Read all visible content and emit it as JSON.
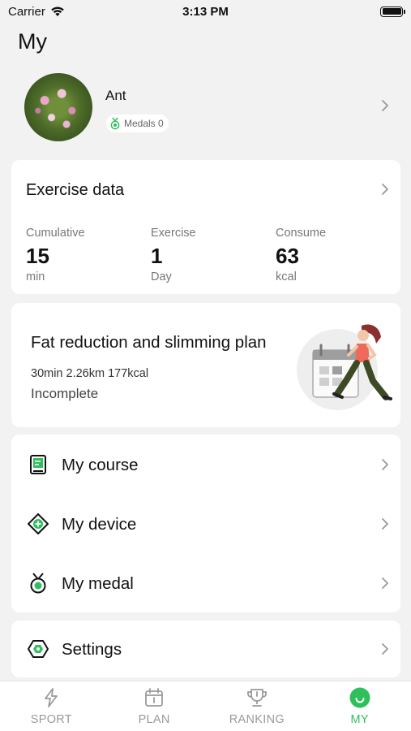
{
  "status_bar": {
    "carrier": "Carrier",
    "time": "3:13 PM"
  },
  "page": {
    "title": "My"
  },
  "profile": {
    "username": "Ant",
    "medals_label": "Medals 0"
  },
  "exercise": {
    "title": "Exercise data",
    "stats": [
      {
        "label": "Cumulative",
        "value": "15",
        "unit": "min"
      },
      {
        "label": "Exercise",
        "value": "1",
        "unit": "Day"
      },
      {
        "label": "Consume",
        "value": "63",
        "unit": "kcal"
      }
    ]
  },
  "plan": {
    "title": "Fat reduction and slimming plan",
    "stats": "30min 2.26km 177kcal",
    "status": "Incomplete"
  },
  "menu": {
    "course": "My course",
    "device": "My device",
    "medal": "My medal",
    "settings": "Settings"
  },
  "tabs": {
    "sport": "SPORT",
    "plan": "PLAN",
    "ranking": "RANKING",
    "my": "MY"
  },
  "colors": {
    "accent": "#2fbf5d",
    "background": "#f2f2f3",
    "card": "#ffffff"
  }
}
